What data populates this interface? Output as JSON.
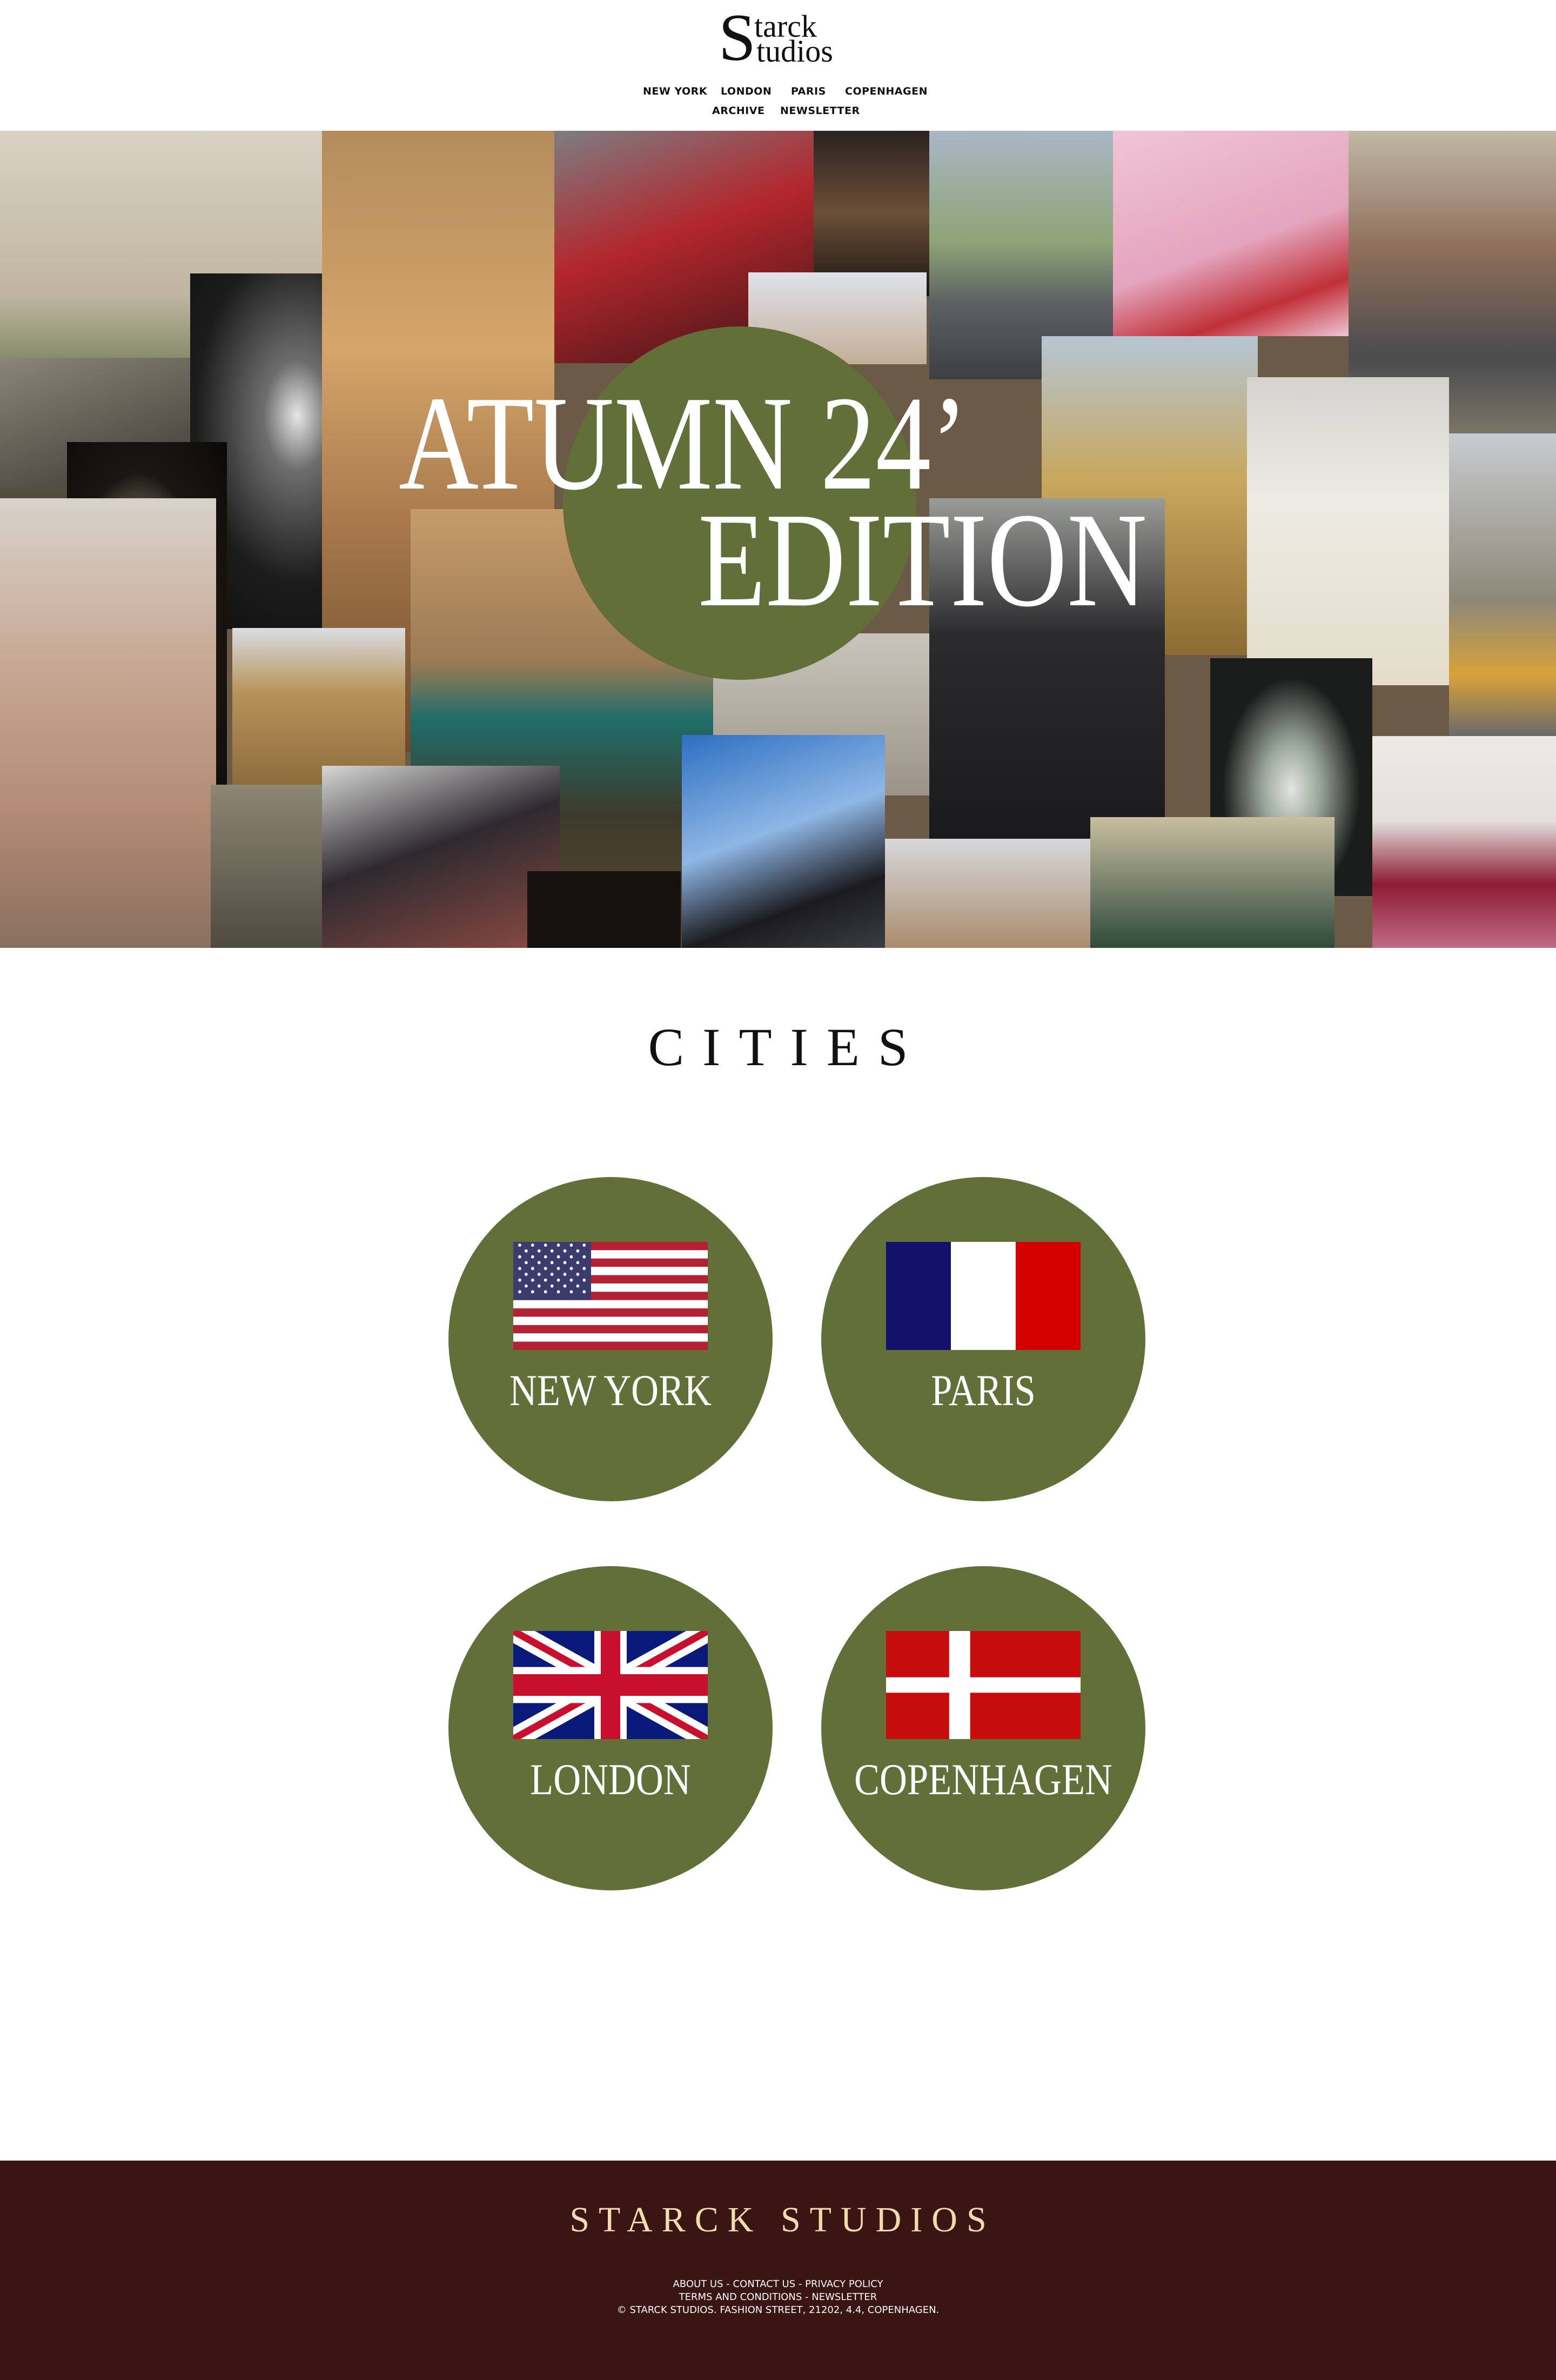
{
  "brand": {
    "logo_initial": "S",
    "logo_line1": "tarck",
    "logo_line2": "tudios"
  },
  "nav": {
    "items": [
      {
        "label": "NEW YORK"
      },
      {
        "label": "LONDON"
      },
      {
        "label": "PARIS"
      },
      {
        "label": "COPENHAGEN"
      },
      {
        "label": "ARCHIVE"
      },
      {
        "label": "NEWSLETTER"
      }
    ]
  },
  "hero": {
    "title_line1": "ATUMN 24’",
    "title_line2": "EDITION",
    "circle_color": "#636f38"
  },
  "cities": {
    "heading": "CITIES",
    "circle_color": "#636f38",
    "items": [
      {
        "label": "NEW YORK",
        "flag": "usa-flag-icon"
      },
      {
        "label": "PARIS",
        "flag": "france-flag-icon"
      },
      {
        "label": "LONDON",
        "flag": "uk-flag-icon"
      },
      {
        "label": "COPENHAGEN",
        "flag": "denmark-flag-icon"
      }
    ]
  },
  "footer": {
    "background": "#3a1514",
    "brand": "STARCK STUDIOS",
    "brand_color": "#f1dcae",
    "links_row1": [
      "ABOUT US",
      "CONTACT US",
      "PRIVACY POLICY"
    ],
    "links_row2": [
      "TERMS AND CONDITIONS",
      "NEWSLETTER"
    ],
    "separator": " - ",
    "copyright": "© STARCK STUDIOS. FASHION STREET, 21202, 4.4, COPENHAGEN."
  }
}
